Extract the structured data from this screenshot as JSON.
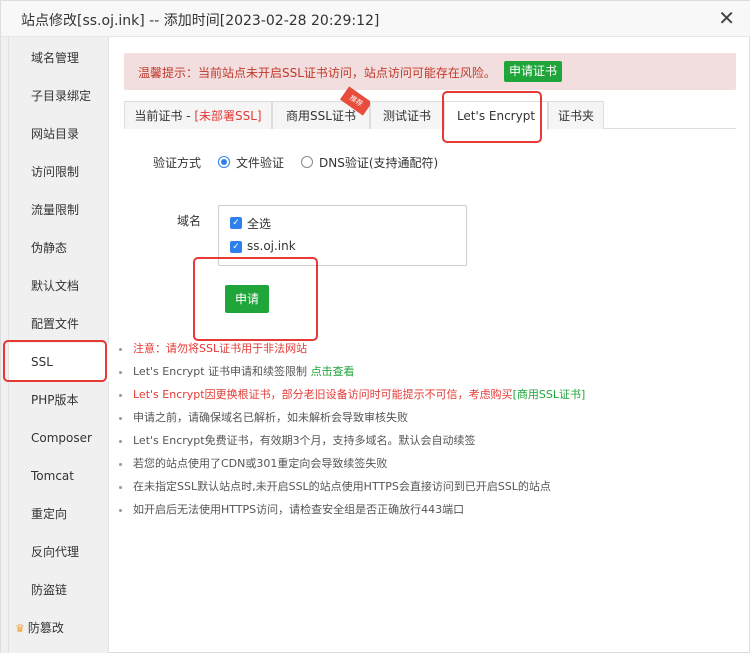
{
  "window": {
    "title": "站点修改[ss.oj.ink] -- 添加时间[2023-02-28 20:29:12]",
    "close_label": "✕"
  },
  "sidebar": {
    "items": [
      {
        "label": "域名管理"
      },
      {
        "label": "子目录绑定"
      },
      {
        "label": "网站目录"
      },
      {
        "label": "访问限制"
      },
      {
        "label": "流量限制"
      },
      {
        "label": "伪静态"
      },
      {
        "label": "默认文档"
      },
      {
        "label": "配置文件"
      },
      {
        "label": "SSL"
      },
      {
        "label": "PHP版本"
      },
      {
        "label": "Composer"
      },
      {
        "label": "Tomcat"
      },
      {
        "label": "重定向"
      },
      {
        "label": "反向代理"
      },
      {
        "label": "防盗链"
      },
      {
        "label": "防篡改"
      }
    ],
    "active": "SSL"
  },
  "alert": {
    "text": "温馨提示：当前站点未开启SSL证书访问，站点访问可能存在风险。",
    "button": "申请证书"
  },
  "tabs": [
    {
      "label": "当前证书 - ",
      "suffix": "[未部署SSL]"
    },
    {
      "label": "商用SSL证书",
      "ribbon": "推荐"
    },
    {
      "label": "测试证书"
    },
    {
      "label": "Let's Encrypt"
    },
    {
      "label": "证书夹"
    }
  ],
  "active_tab": "Let's Encrypt",
  "form": {
    "verify_label": "验证方式",
    "options": [
      "文件验证",
      "DNS验证(支持通配符)"
    ],
    "selected_option": "文件验证",
    "domain_label": "域名",
    "domains": [
      {
        "label": "全选",
        "checked": true
      },
      {
        "label": "ss.oj.ink",
        "checked": true
      }
    ],
    "apply_button": "申请"
  },
  "notes": [
    {
      "text": "注意：请勿将SSL证书用于非法网站",
      "color": "#e53935"
    },
    {
      "text": "Let's Encrypt 证书申请和续签限制 ",
      "link": "点击查看"
    },
    {
      "text": "Let's Encrypt因更换根证书，部分老旧设备访问时可能提示不可信，考虑购买",
      "link": "[商用SSL证书]",
      "color": "#e53935"
    },
    {
      "text": "申请之前，请确保域名已解析，如未解析会导致审核失败"
    },
    {
      "text": "Let's Encrypt免费证书，有效期3个月，支持多域名。默认会自动续签"
    },
    {
      "text": "若您的站点使用了CDN或301重定向会导致续签失败"
    },
    {
      "text": "在未指定SSL默认站点时,未开启SSL的站点使用HTTPS会直接访问到已开启SSL的站点"
    },
    {
      "text": "如开启后无法使用HTTPS访问，请检查安全组是否正确放行443端口"
    }
  ],
  "colors": {
    "accent_green": "#20a53a",
    "warning_red": "#e53935",
    "highlight_box": "#e53935",
    "radio_blue": "#2f80ed"
  }
}
